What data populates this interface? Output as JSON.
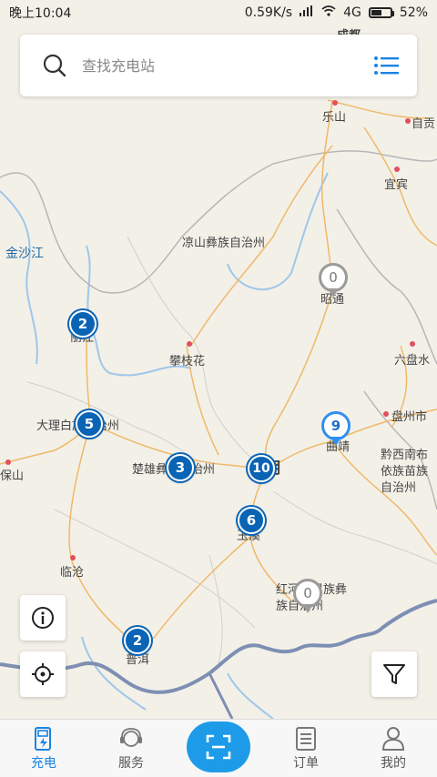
{
  "status": {
    "time": "晚上10:04",
    "speed": "0.59K/s",
    "network": "4G",
    "battery": "52%",
    "battery_level": 0.52
  },
  "search": {
    "placeholder": "查找充电站"
  },
  "map_labels": {
    "chengdu": "成都",
    "leshan": "乐山",
    "zigong": "自贡",
    "yibin": "宜宾",
    "jinshajiang": "金沙江",
    "liangshan": "凉山彝族自治州",
    "zhaotong": "昭通",
    "lijiang": "丽江",
    "panzhihua": "攀枝花",
    "liupanshui": "六盘水",
    "dali": "大理白族自治州",
    "panzhou": "盘州市",
    "qujing": "曲靖",
    "chuxiong": "楚雄彝族自治州",
    "kunming": "昆明",
    "qianxinan": "黔西南布依族苗族自治州",
    "baoshan": "保山",
    "yuxi": "玉溪",
    "lincang": "临沧",
    "honghe": "红河哈尼族彝族自治州",
    "puer": "普洱"
  },
  "clusters": [
    {
      "id": "lijiang",
      "count": "2"
    },
    {
      "id": "dali",
      "count": "5"
    },
    {
      "id": "chuxiong",
      "count": "3"
    },
    {
      "id": "kunming",
      "count": "10"
    },
    {
      "id": "yuxi",
      "count": "6"
    },
    {
      "id": "puer",
      "count": "2"
    }
  ],
  "pins": [
    {
      "id": "zhaotong",
      "count": "0",
      "style": "gray"
    },
    {
      "id": "qujing",
      "count": "9",
      "style": "blue"
    },
    {
      "id": "honghe",
      "count": "0",
      "style": "gray"
    }
  ],
  "tabs": [
    {
      "label": "充电",
      "icon": "charging-station-icon",
      "active": true
    },
    {
      "label": "服务",
      "icon": "customer-service-icon",
      "active": false
    },
    {
      "label": "",
      "icon": "scan-icon",
      "active": false
    },
    {
      "label": "订单",
      "icon": "order-list-icon",
      "active": false
    },
    {
      "label": "我的",
      "icon": "user-icon",
      "active": false
    }
  ],
  "colors": {
    "accent": "#1a84e5",
    "cluster": "#0a64b5",
    "scan_button": "#1e9be8"
  }
}
